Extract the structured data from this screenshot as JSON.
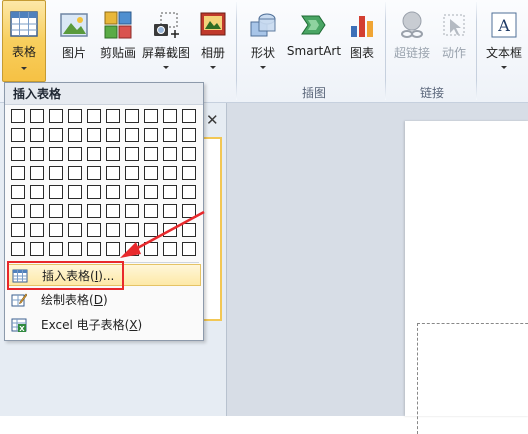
{
  "ribbon": {
    "buttons": {
      "table": "表格",
      "picture": "图片",
      "clipart": "剪贴画",
      "screenshot": "屏幕截图",
      "album": "相册",
      "shapes": "形状",
      "smartart": "SmartArt",
      "chart": "图表",
      "hyperlink": "超链接",
      "action": "动作",
      "textbox": "文本框"
    },
    "groups": {
      "illustrations": "插图",
      "links": "链接"
    }
  },
  "dropdown": {
    "header": "插入表格",
    "grid": {
      "rows": 8,
      "cols": 10
    },
    "items": [
      {
        "label": "插入表格(",
        "hotkey": "I",
        "suffix": ")..."
      },
      {
        "label": "绘制表格(",
        "hotkey": "D",
        "suffix": ")"
      },
      {
        "label": "Excel 电子表格(",
        "hotkey": "X",
        "suffix": ")"
      }
    ]
  },
  "pane": {
    "close": "✕"
  },
  "colors": {
    "active": "#f6c144",
    "highlight": "#fde9a7",
    "annotation": "#e8292c"
  },
  "icons": {
    "table": "table-icon",
    "picture": "picture-icon",
    "clipart": "clipart-icon",
    "screenshot": "screenshot-icon",
    "album": "photo-album-icon",
    "shapes": "shapes-icon",
    "smartart": "smartart-icon",
    "chart": "bar-chart-icon",
    "hyperlink": "hyperlink-icon",
    "action": "action-icon",
    "textbox": "text-box-icon"
  }
}
